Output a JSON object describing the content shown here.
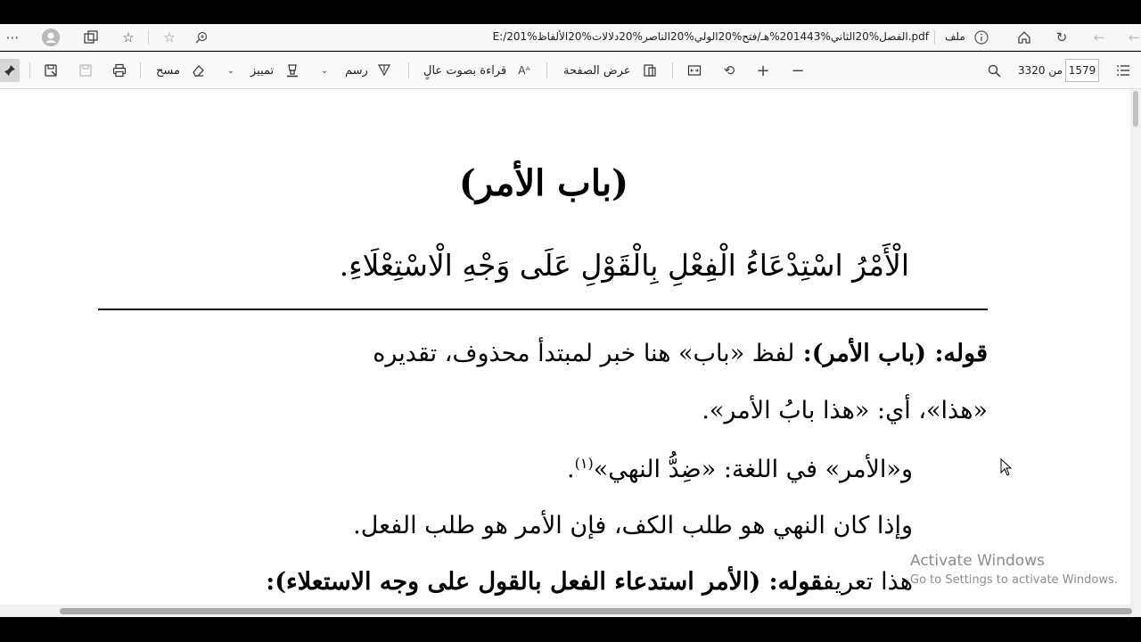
{
  "browser": {
    "address_url": "E:/201%الفصل%20الثاني%201443%هـ/فتح%20الولي%20الناصر%20دلالات%20الألفاظ.pdf",
    "file_label": "ملف",
    "icons": [
      "more-icon",
      "profile-icon",
      "collections-icon",
      "favorites-icon",
      "add-favorite-icon",
      "zoom-icon",
      "info-icon",
      "home-icon",
      "refresh-icon",
      "back-icon",
      "forward-icon"
    ]
  },
  "pdf_toolbar": {
    "page_current": "1579",
    "page_total_text": "من 3320",
    "page_view_label": "عرض الصفحة",
    "read_aloud_label": "قراءة بصوت عالٍ",
    "draw_label": "رسم",
    "highlight_label": "تمييز",
    "erase_label": "مسح",
    "icons": [
      "contents-icon",
      "search-icon",
      "zoom-out-icon",
      "zoom-in-icon",
      "rotate-icon",
      "fit-page-icon",
      "page-view-icon",
      "read-aloud-icon",
      "draw-icon",
      "highlight-icon",
      "erase-icon",
      "print-icon",
      "save-icon",
      "save-as-icon",
      "pin-icon"
    ]
  },
  "document": {
    "title": "(باب الأمر)",
    "definition": "الْأَمْرُ اسْتِدْعَاءُ الْفِعْلِ بِالْقَوْلِ عَلَى وَجْهِ الْاسْتِعْلَاءِ.",
    "line1_bold": "قوله: (باب الأمر): ",
    "line1_rest": "لفظ «باب» هنا خبر لمبتدأ محذوف، تقديره",
    "line2": "«هذا»، أي: «هذا بابُ الأمر».",
    "line3": "و«الأمر» في اللغة: «ضِدُّ النهي»",
    "line3_footnote": "(١)",
    "line3_end": ".",
    "line4": "وإذا كان النهي هو طلب الكف، فإن الأمر هو طلب الفعل.",
    "line5_bold": "قوله: (الأمر استدعاء الفعل بالقول على وجه الاستعلاء): ",
    "line5_rest": "هذا تعريف"
  },
  "watermark": {
    "line1": "Activate Windows",
    "line2": "Go to Settings to activate Windows."
  }
}
